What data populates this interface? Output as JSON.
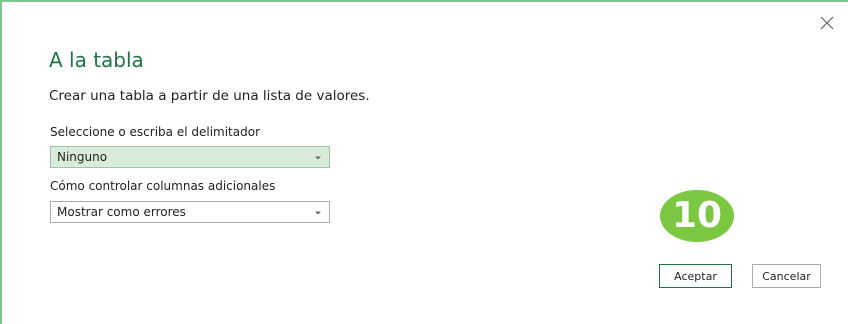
{
  "dialog": {
    "title": "A la tabla",
    "description": "Crear una tabla a partir de una lista de valores.",
    "close_icon": "close-icon"
  },
  "delimiter": {
    "label": "Seleccione o escriba el delimitador",
    "value": "Ninguno"
  },
  "extra_columns": {
    "label": "Cómo controlar columnas adicionales",
    "value": "Mostrar como errores"
  },
  "badge": {
    "text": "10",
    "color": "#7cc742"
  },
  "buttons": {
    "accept_label": "Aceptar",
    "cancel_label": "Cancelar"
  },
  "colors": {
    "accent": "#217346",
    "frame": "#7cc48c",
    "selected_field": "#d9ecd9"
  }
}
